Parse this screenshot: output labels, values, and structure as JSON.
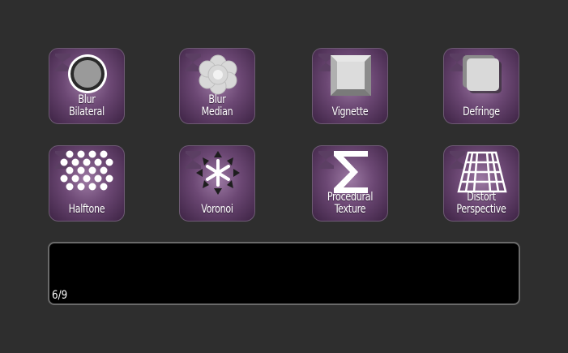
{
  "tiles": [
    {
      "id": "blur-bilateral",
      "lines": [
        "Blur",
        "Bilateral"
      ],
      "icon": "circle-ring-icon"
    },
    {
      "id": "blur-median",
      "lines": [
        "Blur",
        "Median"
      ],
      "icon": "flower-blob-icon"
    },
    {
      "id": "vignette",
      "lines": [
        "Vignette"
      ],
      "icon": "beveled-square-icon"
    },
    {
      "id": "defringe",
      "lines": [
        "Defringe"
      ],
      "icon": "stacked-squares-icon"
    },
    {
      "id": "halftone",
      "lines": [
        "Halftone"
      ],
      "icon": "dot-grid-icon"
    },
    {
      "id": "voronoi",
      "lines": [
        "Voronoi"
      ],
      "icon": "asterisk-burst-icon"
    },
    {
      "id": "procedural-texture",
      "lines": [
        "Procedural",
        "Texture"
      ],
      "icon": "sigma-icon"
    },
    {
      "id": "distort-perspective",
      "lines": [
        "Distort",
        "Perspective"
      ],
      "icon": "perspective-grid-icon"
    }
  ],
  "badge_icon": "sigma-badge-icon",
  "status": {
    "page_indicator": "6/9"
  },
  "colors": {
    "background": "#2e2e2e",
    "tile_center": "#9d7aa4",
    "tile_edge": "#3d2344",
    "panel": "#000000"
  }
}
